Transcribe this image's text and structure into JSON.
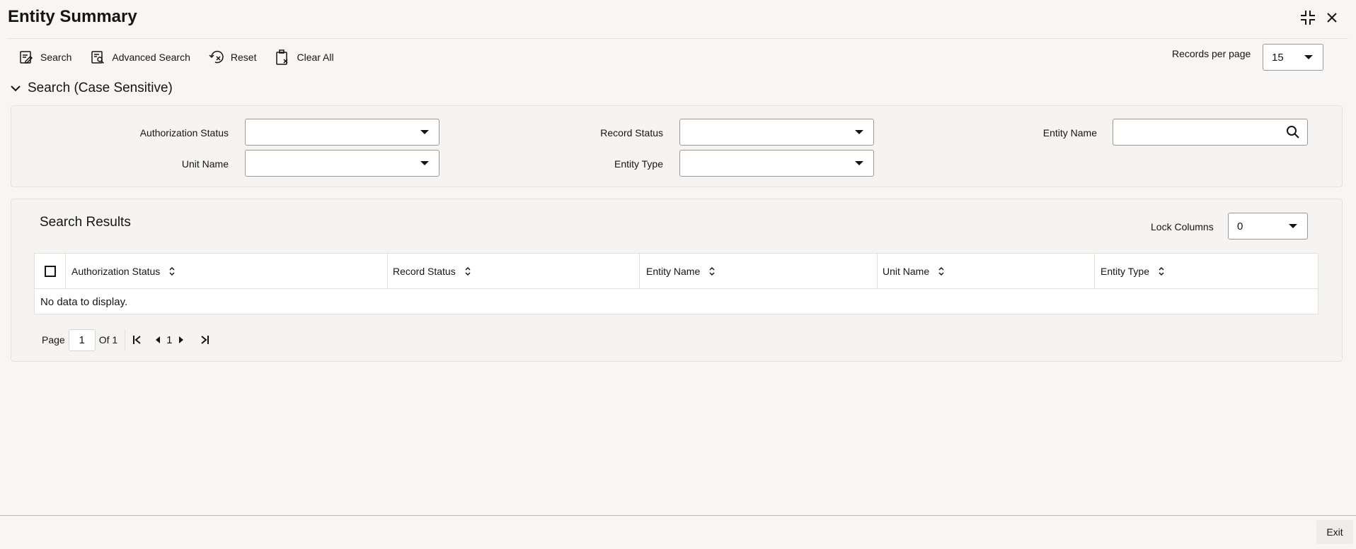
{
  "page": {
    "title": "Entity Summary"
  },
  "window_controls": {
    "restore_icon": "collapse-icon",
    "close_icon": "close-icon"
  },
  "toolbar": {
    "search_label": "Search",
    "advanced_search_label": "Advanced Search",
    "reset_label": "Reset",
    "clear_all_label": "Clear All"
  },
  "records_per_page": {
    "label": "Records per page",
    "value": "15"
  },
  "search_section": {
    "title": "Search (Case Sensitive)",
    "fields": {
      "authorization_status": {
        "label": "Authorization Status",
        "value": ""
      },
      "record_status": {
        "label": "Record Status",
        "value": ""
      },
      "entity_name": {
        "label": "Entity Name",
        "value": ""
      },
      "unit_name": {
        "label": "Unit Name",
        "value": ""
      },
      "entity_type": {
        "label": "Entity Type",
        "value": ""
      }
    }
  },
  "results": {
    "title": "Search Results",
    "lock_columns": {
      "label": "Lock Columns",
      "value": "0"
    },
    "columns": [
      "Authorization Status",
      "Record Status",
      "Entity Name",
      "Unit Name",
      "Entity Type"
    ],
    "empty_message": "No data to display."
  },
  "pagination": {
    "page_label": "Page",
    "current_page": "1",
    "of_label": "Of 1",
    "page_number": "1"
  },
  "footer": {
    "exit_label": "Exit"
  },
  "colors": {
    "background": "#f7f6f4",
    "panel": "#f5f4f2",
    "border": "#e4e1dd",
    "text": "#161513"
  }
}
